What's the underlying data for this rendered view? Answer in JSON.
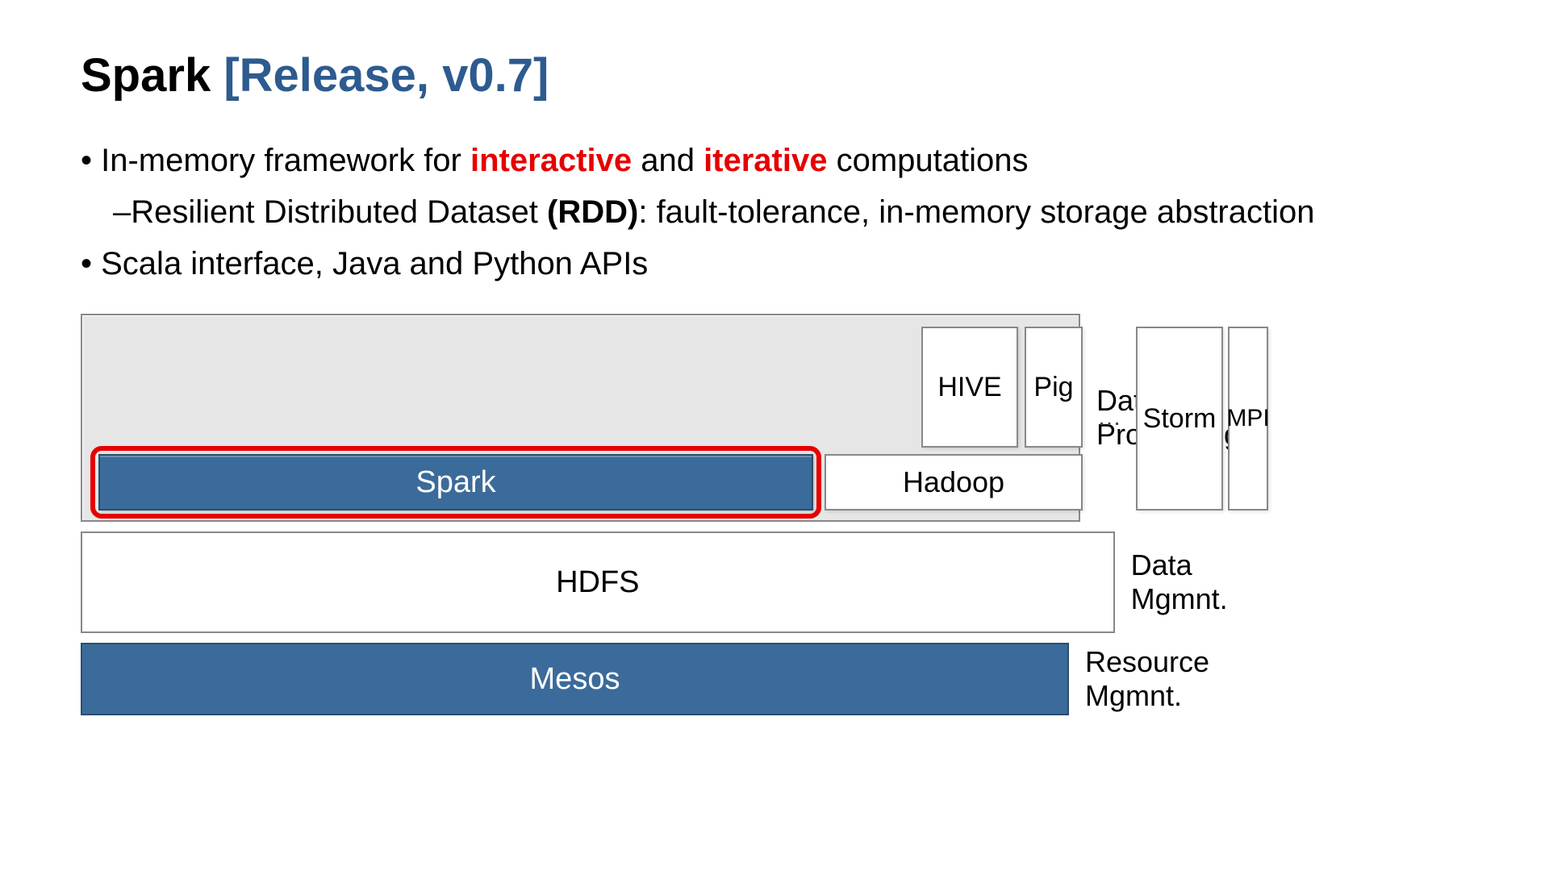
{
  "title": {
    "main": "Spark ",
    "release": "[Release, v0.7]"
  },
  "bullets": {
    "b1_pre": "In-memory framework for ",
    "b1_em1": "interactive",
    "b1_mid": " and ",
    "b1_em2": "iterative",
    "b1_post": " computations",
    "b1s_pre": "Resilient Distributed Dataset ",
    "b1s_bold": "(RDD)",
    "b1s_post": ": fault-tolerance, in-memory storage abstraction",
    "b2": "Scala interface, Java and Python APIs"
  },
  "diagram": {
    "data_processing_label": "Data Processing",
    "data_mgmt_label": "Data Mgmnt.",
    "resource_mgmt_label": "Resource Mgmnt.",
    "spark": "Spark",
    "hadoop": "Hadoop",
    "hive": "HIVE",
    "pig": "Pig",
    "ellipsis": "…",
    "storm": "Storm",
    "mpi": "MPI",
    "hdfs": "HDFS",
    "mesos": "Mesos"
  }
}
